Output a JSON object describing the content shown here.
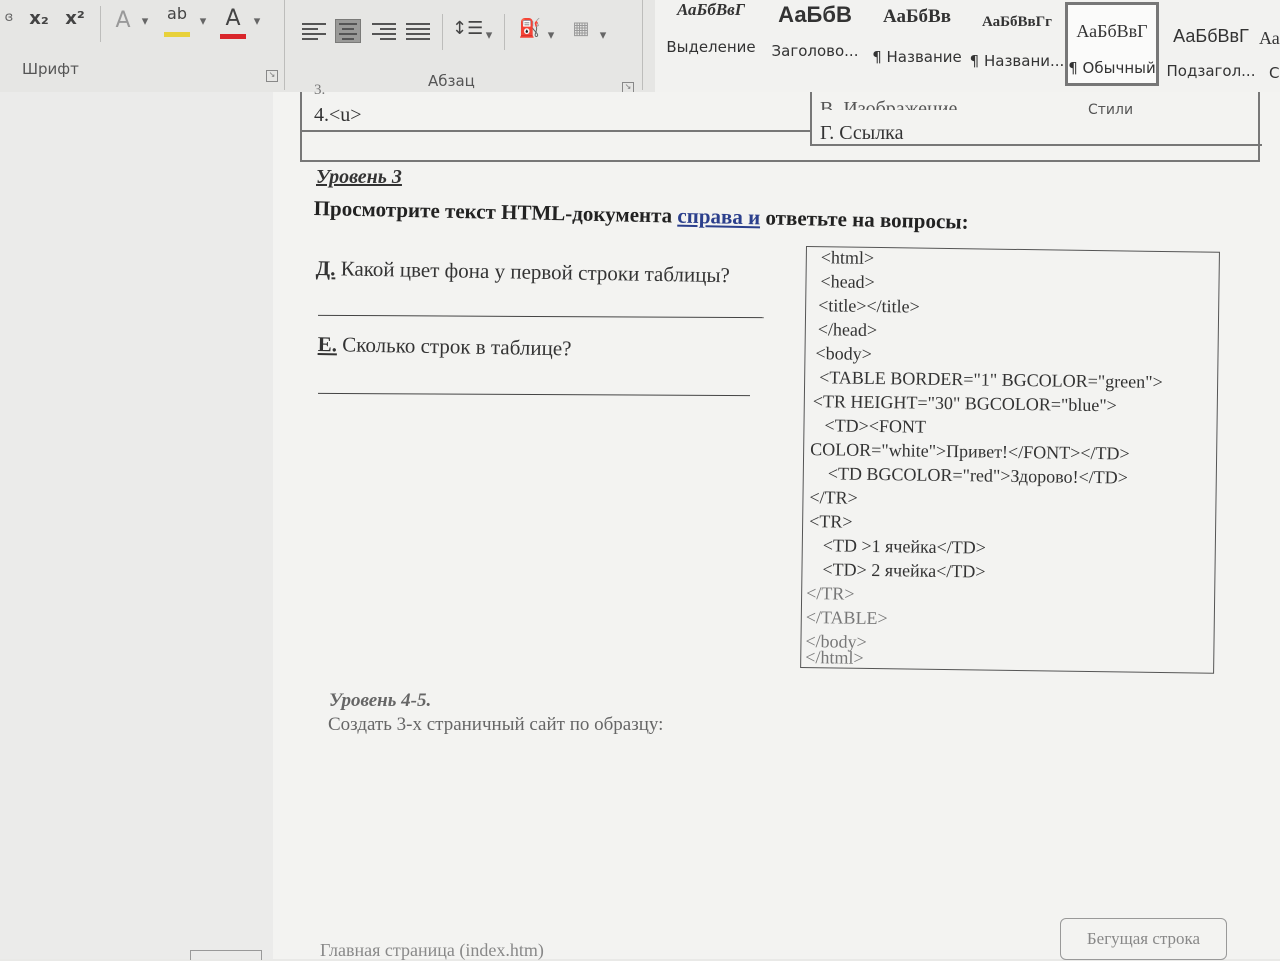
{
  "ribbon": {
    "font_group": {
      "label": "Шрифт",
      "cut_glyph": "ɞ",
      "subscript": "x₂",
      "superscript": "x²",
      "text_effects": "A",
      "highlight": "ab",
      "font_color": "A",
      "font_color_bar": "#d9262b",
      "highlight_bar": "#e8d13a"
    },
    "paragraph_group": {
      "label": "Абзац"
    },
    "styles_group": {
      "label": "Стили",
      "styles": [
        {
          "sample": "АаБбВвГ",
          "name": "Выделение"
        },
        {
          "sample": "АаБбВ",
          "name": "Заголово..."
        },
        {
          "sample": "АаБбВв",
          "name": "¶ Название"
        },
        {
          "sample": "АаБбВвГг",
          "name": "¶ Названи..."
        },
        {
          "sample": "АаБбВвГ",
          "name": "¶ Обычный"
        },
        {
          "sample": "АаБбВвГ",
          "name": "Подзагол..."
        },
        {
          "sample": "Аа",
          "name": "С"
        }
      ]
    }
  },
  "document": {
    "top_table": {
      "left_cell": "4.<u>",
      "right_cell_partial": "В. Изображение",
      "right_cell": "Г. Ссылка",
      "cut_row": "3."
    },
    "level3_heading": "Уровень 3",
    "instruction": {
      "before": "Просмотрите текст HTML-документа ",
      "link": "справа и",
      "after": " ответьте на вопросы:"
    },
    "questions": [
      {
        "letter": "Д.",
        "text": " Какой цвет фона у первой строки таблицы?"
      },
      {
        "letter": "Е.",
        "text": " Сколько строк в таблице?"
      }
    ],
    "code_lines": [
      "<html>",
      "<head>",
      "<title></title>",
      "</head>",
      "<body>",
      " <TABLE BORDER=\"1\" BGCOLOR=\"green\">",
      "<TR HEIGHT=\"30\" BGCOLOR=\"blue\">",
      "   <TD><FONT",
      "COLOR=\"white\">Привет!</FONT></TD>",
      "   <TD BGCOLOR=\"red\">Здорово!</TD>",
      "</TR>",
      "<TR>",
      "   <TD >1 ячейка</TD>",
      "   <TD> 2 ячейка</TD>",
      "</TR>",
      "</TABLE>",
      "</body>",
      "</html>"
    ],
    "level45_heading": "Уровень 4-5.",
    "create_site": "Создать 3-х страничный сайт по образцу:",
    "bottom_left": "Главная страница (index.htm)",
    "bottom_box": "Бегущая строка"
  }
}
